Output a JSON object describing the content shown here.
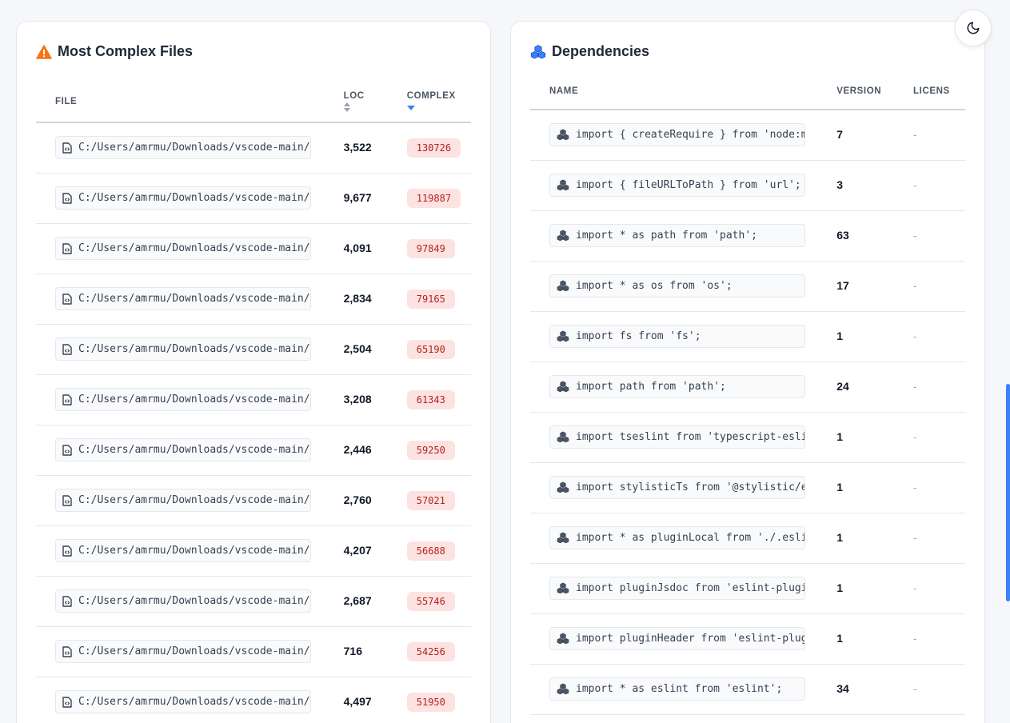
{
  "complex_files": {
    "title": "Most Complex Files",
    "columns": {
      "file": "FILE",
      "loc": "LOC",
      "complexity": "COMPLEX"
    },
    "rows": [
      {
        "path": "C:/Users/amrmu/Downloads/vscode-main/v",
        "loc": "3,522",
        "complexity": "130726"
      },
      {
        "path": "C:/Users/amrmu/Downloads/vscode-main/v",
        "loc": "9,677",
        "complexity": "119887"
      },
      {
        "path": "C:/Users/amrmu/Downloads/vscode-main/v",
        "loc": "4,091",
        "complexity": "97849"
      },
      {
        "path": "C:/Users/amrmu/Downloads/vscode-main/v",
        "loc": "2,834",
        "complexity": "79165"
      },
      {
        "path": "C:/Users/amrmu/Downloads/vscode-main/v",
        "loc": "2,504",
        "complexity": "65190"
      },
      {
        "path": "C:/Users/amrmu/Downloads/vscode-main/v",
        "loc": "3,208",
        "complexity": "61343"
      },
      {
        "path": "C:/Users/amrmu/Downloads/vscode-main/v",
        "loc": "2,446",
        "complexity": "59250"
      },
      {
        "path": "C:/Users/amrmu/Downloads/vscode-main/v",
        "loc": "2,760",
        "complexity": "57021"
      },
      {
        "path": "C:/Users/amrmu/Downloads/vscode-main/v",
        "loc": "4,207",
        "complexity": "56688"
      },
      {
        "path": "C:/Users/amrmu/Downloads/vscode-main/v",
        "loc": "2,687",
        "complexity": "55746"
      },
      {
        "path": "C:/Users/amrmu/Downloads/vscode-main/v",
        "loc": "716",
        "complexity": "54256"
      },
      {
        "path": "C:/Users/amrmu/Downloads/vscode-main/v",
        "loc": "4,497",
        "complexity": "51950"
      }
    ]
  },
  "dependencies": {
    "title": "Dependencies",
    "columns": {
      "name": "NAME",
      "version": "VERSION",
      "license": "LICENS"
    },
    "rows": [
      {
        "name": "import { createRequire } from 'node:mo",
        "version": "7",
        "license": "-"
      },
      {
        "name": "import { fileURLToPath } from 'url';",
        "version": "3",
        "license": "-"
      },
      {
        "name": "import * as path from 'path';",
        "version": "63",
        "license": "-"
      },
      {
        "name": "import * as os from 'os';",
        "version": "17",
        "license": "-"
      },
      {
        "name": "import fs from 'fs';",
        "version": "1",
        "license": "-"
      },
      {
        "name": "import path from 'path';",
        "version": "24",
        "license": "-"
      },
      {
        "name": "import tseslint from 'typescript-eslint",
        "version": "1",
        "license": "-"
      },
      {
        "name": "import stylisticTs from '@stylistic/es",
        "version": "1",
        "license": "-"
      },
      {
        "name": "import * as pluginLocal from './.eslin",
        "version": "1",
        "license": "-"
      },
      {
        "name": "import pluginJsdoc from 'eslint-plugin",
        "version": "1",
        "license": "-"
      },
      {
        "name": "import pluginHeader from 'eslint-plug",
        "version": "1",
        "license": "-"
      },
      {
        "name": "import * as eslint from 'eslint';",
        "version": "34",
        "license": "-"
      }
    ]
  },
  "icons": {
    "warning": "warning-triangle-icon",
    "dependencies": "cubes-icon",
    "file": "file-code-icon",
    "package": "cubes-icon",
    "theme": "moon-icon",
    "sort_neutral": "sort-icon",
    "sort_desc": "sort-desc-icon"
  },
  "colors": {
    "warning": "#f97316",
    "accent": "#3b82f6",
    "badge_bg": "#fde2e2",
    "badge_text": "#b42318",
    "page_bg": "#f5f7fa"
  }
}
